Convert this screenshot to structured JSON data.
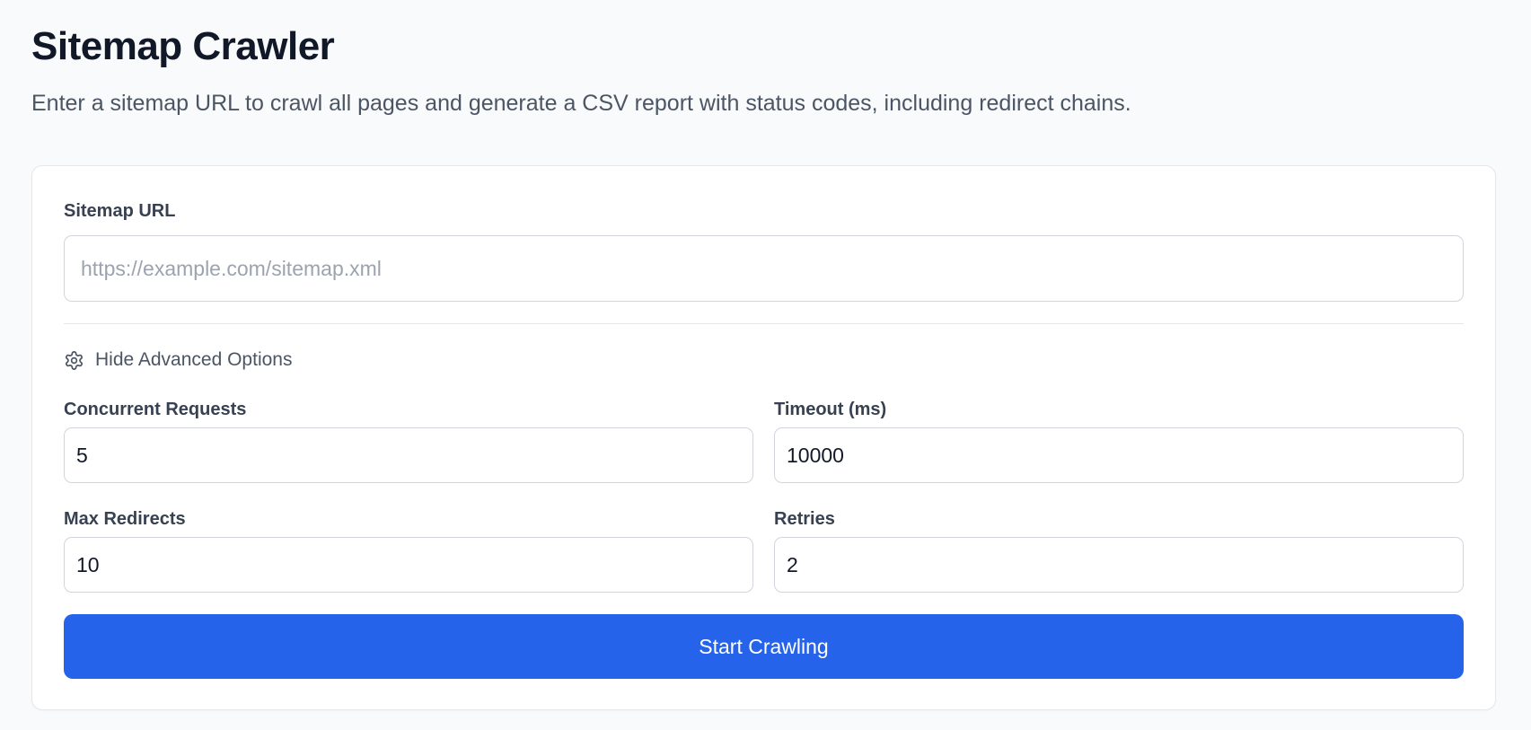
{
  "header": {
    "title": "Sitemap Crawler",
    "subtitle": "Enter a sitemap URL to crawl all pages and generate a CSV report with status codes, including redirect chains."
  },
  "form": {
    "sitemap_url": {
      "label": "Sitemap URL",
      "value": "",
      "placeholder": "https://example.com/sitemap.xml"
    },
    "advanced_toggle": {
      "label": "Hide Advanced Options",
      "icon": "gear-icon"
    },
    "concurrent_requests": {
      "label": "Concurrent Requests",
      "value": "5"
    },
    "timeout": {
      "label": "Timeout (ms)",
      "value": "10000"
    },
    "max_redirects": {
      "label": "Max Redirects",
      "value": "10"
    },
    "retries": {
      "label": "Retries",
      "value": "2"
    },
    "submit_label": "Start Crawling"
  },
  "colors": {
    "background": "#f8fafc",
    "primary_button": "#2563eb",
    "card": "#ffffff"
  }
}
